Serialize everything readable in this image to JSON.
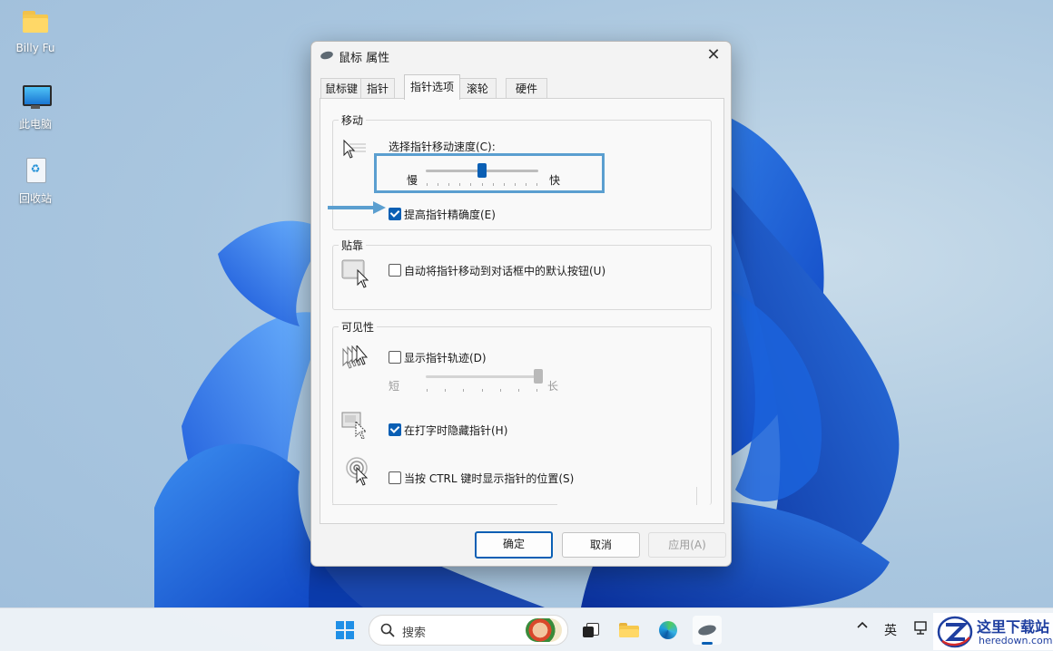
{
  "desktop": {
    "icons": [
      {
        "label": "Billy Fu",
        "icon": "folder-icon"
      },
      {
        "label": "此电脑",
        "icon": "monitor-icon"
      },
      {
        "label": "回收站",
        "icon": "recycle-bin-icon"
      }
    ]
  },
  "dialog": {
    "title": "鼠标 属性",
    "close_glyph": "✕",
    "tabs": [
      "鼠标键",
      "指针",
      "指针选项",
      "滚轮",
      "硬件"
    ],
    "active_tab": "指针选项",
    "motion": {
      "group_label": "移动",
      "speed_label": "选择指针移动速度(C):",
      "slow_label": "慢",
      "fast_label": "快",
      "speed_level": 0.5,
      "precision_label": "提高指针精确度(E)",
      "precision_checked": true
    },
    "snap": {
      "group_label": "贴靠",
      "snap_label": "自动将指针移动到对话框中的默认按钮(U)",
      "snap_checked": false
    },
    "visibility": {
      "group_label": "可见性",
      "trails_label": "显示指针轨迹(D)",
      "trails_checked": false,
      "short_label": "短",
      "long_label": "长",
      "trail_level": 1.0,
      "hide_label": "在打字时隐藏指针(H)",
      "hide_checked": true,
      "ctrl_label": "当按 CTRL 键时显示指针的位置(S)",
      "ctrl_checked": false
    },
    "buttons": {
      "ok": "确定",
      "cancel": "取消",
      "apply": "应用(A)"
    }
  },
  "taskbar": {
    "search_placeholder": "搜索",
    "ime_label": "英"
  },
  "watermark": {
    "title": "这里下载站",
    "url": "heredown.com"
  },
  "colors": {
    "accent": "#0a5fb4",
    "highlight": "#5b9fd0"
  }
}
